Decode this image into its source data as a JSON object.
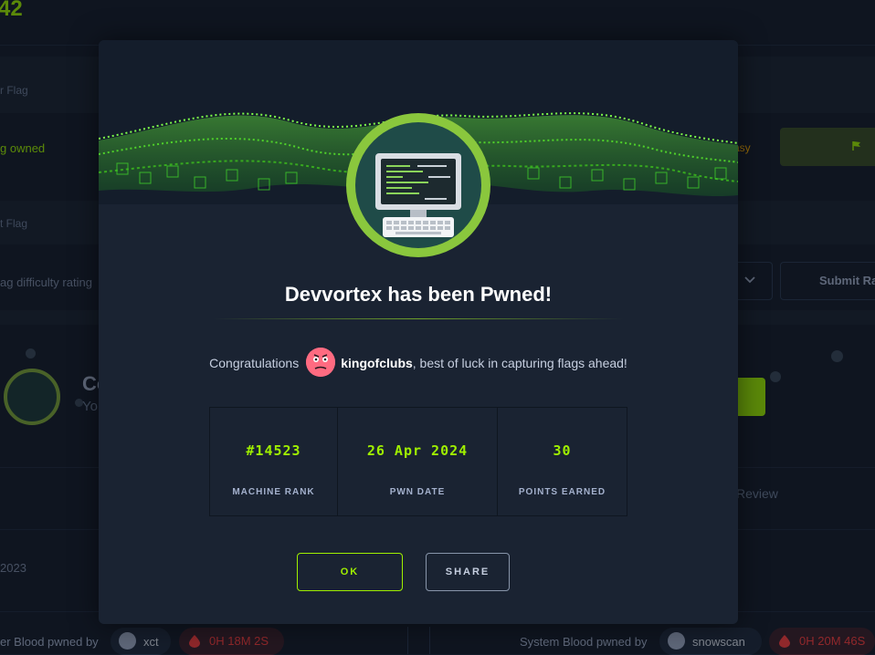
{
  "background": {
    "machine_number_fragment": "42",
    "user_flag_label": "r Flag",
    "owned_status": "g owned",
    "difficulty_badge": "asy",
    "root_flag_label": "t Flag",
    "difficulty_placeholder": "ag difficulty rating",
    "submit_rating_label": "Submit Ra",
    "card_heading_fragment": "Co",
    "card_subtext_fragment": "Yo",
    "review_tab_label": "Review",
    "release_year_fragment": "2023",
    "user_blood": {
      "label": "er Blood pwned by",
      "user": "xct",
      "time": "0H 18M 2S"
    },
    "system_blood": {
      "label": "System Blood pwned by",
      "user": "snowscan",
      "time": "0H 20M 46S"
    }
  },
  "modal": {
    "title": "Devvortex has been Pwned!",
    "congrats_prefix": "Congratulations",
    "username": "kingofclubs",
    "congrats_suffix": ", best of luck in capturing flags ahead!",
    "stats": [
      {
        "value": "#14523",
        "label": "MACHINE RANK"
      },
      {
        "value": "26 Apr 2024",
        "label": "PWN DATE"
      },
      {
        "value": "30",
        "label": "POINTS EARNED"
      }
    ],
    "ok_label": "OK",
    "share_label": "SHARE"
  },
  "colors": {
    "accent": "#9fef00",
    "background": "#141d2b",
    "modal": "#1a2332",
    "blood_red": "#ff3e3e",
    "badge_ring": "#8ac73d"
  },
  "icons": {
    "machine_badge": "computer-monitor-keyboard-icon",
    "user_avatar": "pink-face-avatar-icon",
    "blood": "blood-drop-icon",
    "flag": "flag-icon",
    "chevron": "chevron-down-icon"
  }
}
